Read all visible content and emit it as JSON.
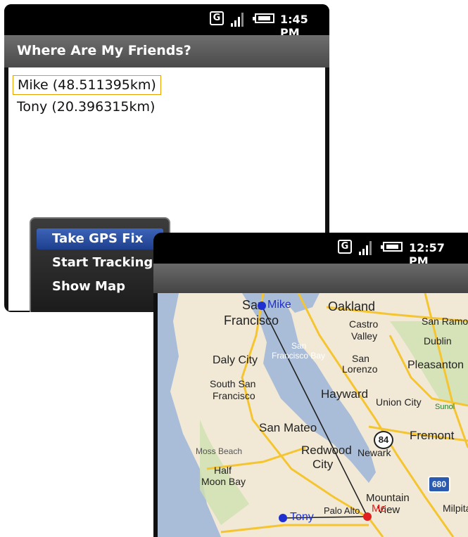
{
  "phone1": {
    "status": {
      "network": "G",
      "time": "1:45 PM"
    },
    "title": "Where Are My Friends?",
    "friends": [
      {
        "label": "Mike (48.511395km)",
        "selected": true
      },
      {
        "label": "Tony (20.396315km)",
        "selected": false
      }
    ],
    "menu": {
      "items": [
        {
          "label": "Take GPS Fix",
          "highlighted": true
        },
        {
          "label": "Start Tracking",
          "highlighted": false
        },
        {
          "label": "Show Map",
          "highlighted": false
        }
      ]
    }
  },
  "phone2": {
    "status": {
      "network": "G",
      "time": "12:57 PM"
    },
    "map": {
      "places": {
        "san_francisco_1": "San",
        "san_francisco_2": "Francisco",
        "oakland": "Oakland",
        "castro_valley_1": "Castro",
        "castro_valley_2": "Valley",
        "san_ramon": "San Ramo",
        "dublin": "Dublin",
        "daly_city": "Daly City",
        "sf_bay_1": "San",
        "sf_bay_2": "Francisco Bay",
        "san_lorenzo_1": "San",
        "san_lorenzo_2": "Lorenzo",
        "pleasanton": "Pleasanton",
        "south_sf_1": "South San",
        "south_sf_2": "Francisco",
        "hayward": "Hayward",
        "union_city": "Union City",
        "sunol": "Sunol",
        "san_mateo": "San Mateo",
        "fremont": "Fremont",
        "moss_beach": "Moss Beach",
        "redwood_city_1": "Redwood",
        "redwood_city_2": "City",
        "newark": "Newark",
        "half_moon_bay_1": "Half",
        "half_moon_bay_2": "Moon Bay",
        "mountain_view_1": "Mountain",
        "mountain_view_2": "View",
        "palo_alto": "Palo Alto",
        "milpitas": "Milpita",
        "highway_84": "84",
        "highway_680": "680"
      },
      "markers": {
        "mike": "Mike",
        "tony": "Tony",
        "me": "Me"
      },
      "colors": {
        "friend_marker": "#1f2fd0",
        "me_marker": "#e02020",
        "water": "#a9bcd8",
        "land": "#f1e9d6",
        "road": "#f5c531"
      }
    }
  }
}
